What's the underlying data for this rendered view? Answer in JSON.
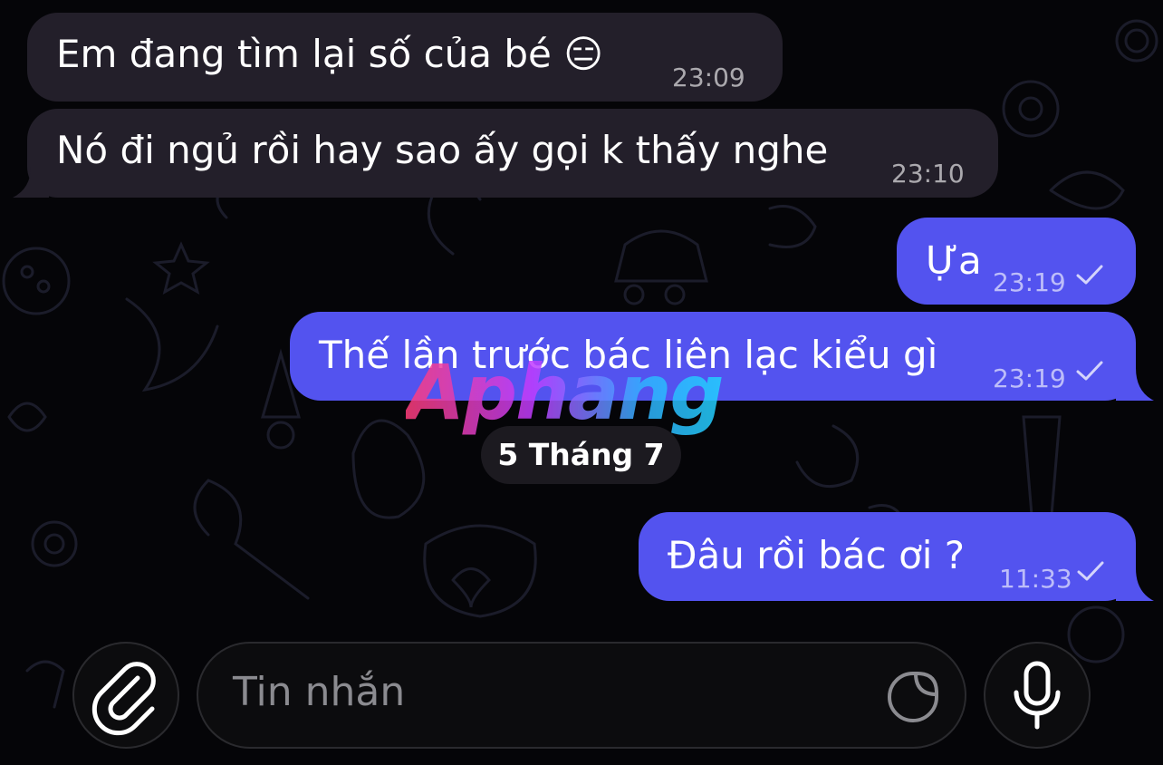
{
  "messages": [
    {
      "id": "m1",
      "side": "incoming",
      "text": "Em đang tìm lại số của bé 😑",
      "time": "23:09"
    },
    {
      "id": "m2",
      "side": "incoming",
      "text": "Nó đi ngủ rồi hay sao ấy gọi k thấy nghe",
      "time": "23:10"
    },
    {
      "id": "m3",
      "side": "outgoing",
      "text": "Ựa",
      "time": "23:19"
    },
    {
      "id": "m4",
      "side": "outgoing",
      "text": "Thế lần trước bác liên lạc kiểu gì",
      "time": "23:19"
    },
    {
      "id": "m5",
      "side": "outgoing",
      "text": "Đâu rồi bác ơi ?",
      "time": "11:33"
    }
  ],
  "date_separator": "5 Tháng 7",
  "watermark": "Aphang",
  "composer": {
    "placeholder": "Tin nhắn",
    "attach_icon": "paperclip-icon",
    "sticker_icon": "sticker-icon",
    "mic_icon": "microphone-icon"
  },
  "colors": {
    "background": "#050508",
    "incoming_bubble": "#231f2a",
    "outgoing_bubble": "#5353ef"
  }
}
